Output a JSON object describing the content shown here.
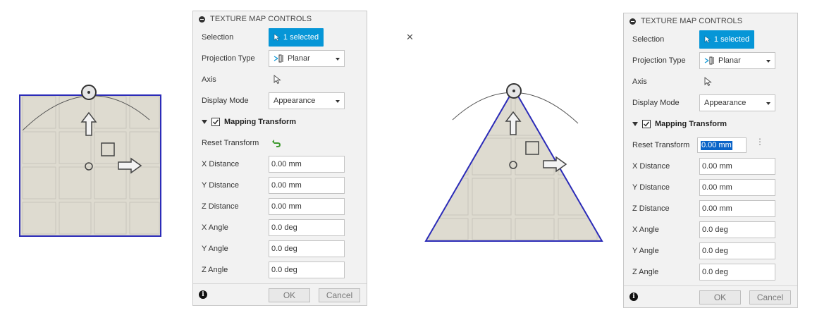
{
  "panels": [
    {
      "title": "TEXTURE MAP CONTROLS",
      "selection_label": "Selection",
      "selection_value": "1 selected",
      "projection_label": "Projection Type",
      "projection_value": "Planar",
      "axis_label": "Axis",
      "display_mode_label": "Display Mode",
      "display_mode_value": "Appearance",
      "group_label": "Mapping Transform",
      "reset_label": "Reset Transform",
      "fields": [
        {
          "label": "X Distance",
          "value": "0.00 mm"
        },
        {
          "label": "Y Distance",
          "value": "0.00 mm"
        },
        {
          "label": "Z Distance",
          "value": "0.00 mm"
        },
        {
          "label": "X Angle",
          "value": "0.0 deg"
        },
        {
          "label": "Y Angle",
          "value": "0.0 deg"
        },
        {
          "label": "Z Angle",
          "value": "0.0 deg"
        }
      ],
      "ok_label": "OK",
      "cancel_label": "Cancel"
    },
    {
      "title": "TEXTURE MAP CONTROLS",
      "selection_label": "Selection",
      "selection_value": "1 selected",
      "projection_label": "Projection Type",
      "projection_value": "Planar",
      "axis_label": "Axis",
      "display_mode_label": "Display Mode",
      "display_mode_value": "Appearance",
      "group_label": "Mapping Transform",
      "reset_label": "Reset Transform",
      "reset_input_value": "0.00 mm",
      "fields": [
        {
          "label": "X Distance",
          "value": "0.00 mm"
        },
        {
          "label": "Y Distance",
          "value": "0.00 mm"
        },
        {
          "label": "Z Distance",
          "value": "0.00 mm"
        },
        {
          "label": "X Angle",
          "value": "0.0 deg"
        },
        {
          "label": "Y Angle",
          "value": "0.0 deg"
        },
        {
          "label": "Z Angle",
          "value": "0.0 deg"
        }
      ],
      "ok_label": "OK",
      "cancel_label": "Cancel"
    }
  ],
  "colors": {
    "accent": "#0696d7",
    "edge": "#2b2bb8",
    "texture": "#dedbd0",
    "reset_green": "#3e9a2e"
  }
}
